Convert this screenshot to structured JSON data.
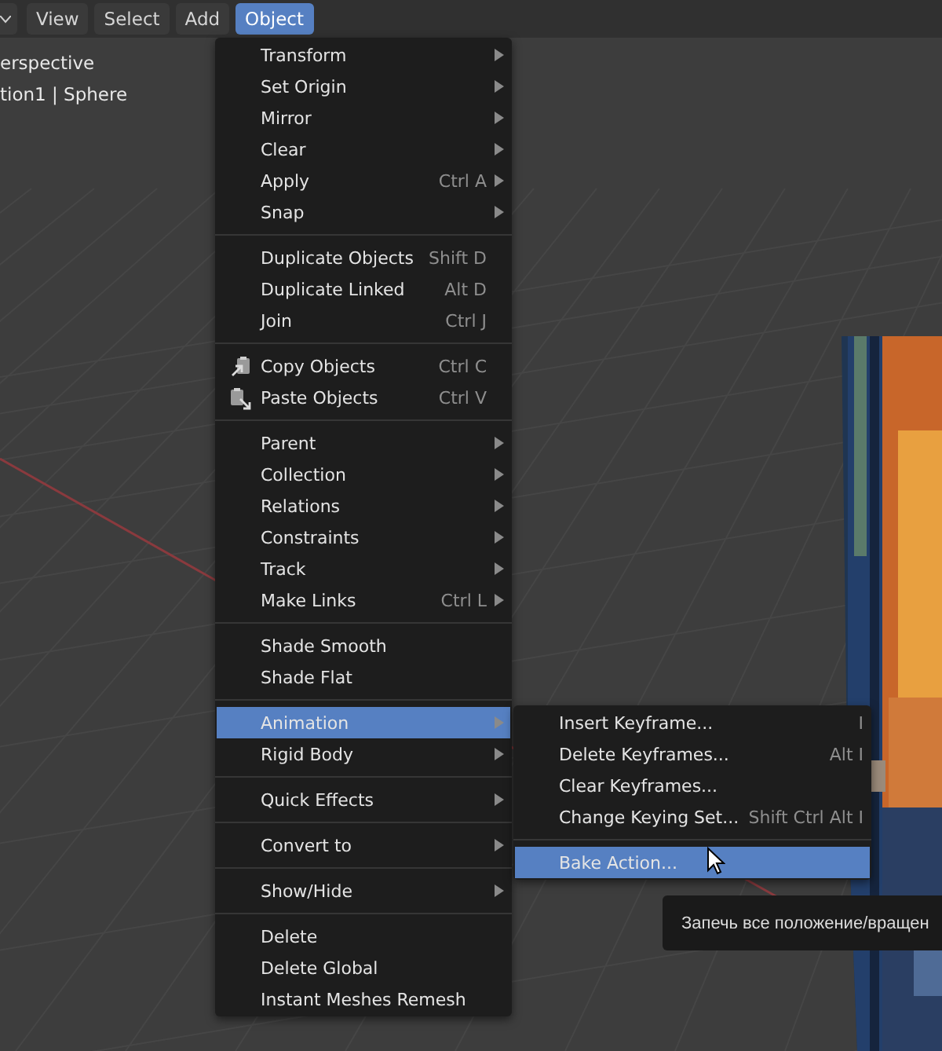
{
  "header": {
    "menus": [
      {
        "label": "View",
        "selected": false
      },
      {
        "label": "Select",
        "selected": false
      },
      {
        "label": "Add",
        "selected": false
      },
      {
        "label": "Object",
        "selected": true
      }
    ]
  },
  "viewport": {
    "overlay_lines": [
      "erspective",
      "tion1 | Sphere"
    ],
    "object": {
      "kind": "picture"
    }
  },
  "menu": {
    "sections": [
      [
        {
          "label": "Transform",
          "submenu": true,
          "selected": false
        },
        {
          "label": "Set Origin",
          "submenu": true,
          "selected": false
        },
        {
          "label": "Mirror",
          "submenu": true,
          "selected": false
        },
        {
          "label": "Clear",
          "submenu": true,
          "selected": false
        },
        {
          "label": "Apply",
          "shortcut": "Ctrl A",
          "submenu": true,
          "selected": false
        },
        {
          "label": "Snap",
          "submenu": true,
          "selected": false
        }
      ],
      [
        {
          "label": "Duplicate Objects",
          "shortcut": "Shift D",
          "submenu": false,
          "selected": false
        },
        {
          "label": "Duplicate Linked",
          "shortcut": "Alt D",
          "submenu": false,
          "selected": false
        },
        {
          "label": "Join",
          "shortcut": "Ctrl J",
          "submenu": false,
          "selected": false
        }
      ],
      [
        {
          "label": "Copy Objects",
          "shortcut": "Ctrl C",
          "submenu": false,
          "selected": false,
          "kind": "copy"
        },
        {
          "label": "Paste Objects",
          "shortcut": "Ctrl V",
          "submenu": false,
          "selected": false,
          "kind": "paste"
        }
      ],
      [
        {
          "label": "Parent",
          "submenu": true,
          "selected": false
        },
        {
          "label": "Collection",
          "submenu": true,
          "selected": false
        },
        {
          "label": "Relations",
          "submenu": true,
          "selected": false
        },
        {
          "label": "Constraints",
          "submenu": true,
          "selected": false
        },
        {
          "label": "Track",
          "submenu": true,
          "selected": false
        },
        {
          "label": "Make Links",
          "shortcut": "Ctrl L",
          "submenu": true,
          "selected": false
        }
      ],
      [
        {
          "label": "Shade Smooth",
          "submenu": false,
          "selected": false
        },
        {
          "label": "Shade Flat",
          "submenu": false,
          "selected": false
        }
      ],
      [
        {
          "label": "Animation",
          "submenu": true,
          "selected": true
        },
        {
          "label": "Rigid Body",
          "submenu": true,
          "selected": false
        }
      ],
      [
        {
          "label": "Quick Effects",
          "submenu": true,
          "selected": false
        }
      ],
      [
        {
          "label": "Convert to",
          "submenu": true,
          "selected": false
        }
      ],
      [
        {
          "label": "Show/Hide",
          "submenu": true,
          "selected": false
        }
      ],
      [
        {
          "label": "Delete",
          "submenu": false,
          "selected": false
        },
        {
          "label": "Delete Global",
          "submenu": false,
          "selected": false
        },
        {
          "label": "Instant Meshes Remesh",
          "submenu": false,
          "selected": false
        }
      ]
    ]
  },
  "submenu": {
    "sections": [
      [
        {
          "label": "Insert Keyframe...",
          "shortcut": "I",
          "selected": false
        },
        {
          "label": "Delete Keyframes...",
          "shortcut": "Alt I",
          "selected": false
        },
        {
          "label": "Clear Keyframes...",
          "selected": false
        },
        {
          "label": "Change Keying Set...",
          "shortcut": "Shift Ctrl Alt I",
          "selected": false
        }
      ],
      [
        {
          "label": "Bake Action...",
          "selected": true
        }
      ]
    ]
  },
  "tooltip": {
    "text": "Запечь все положение/вращен"
  }
}
